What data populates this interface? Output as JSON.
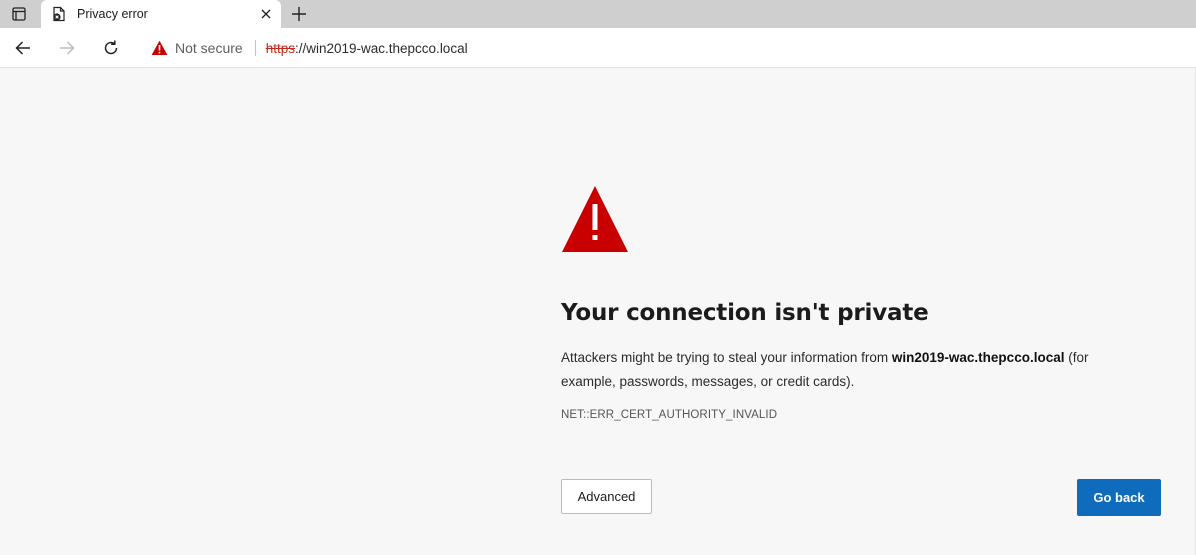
{
  "tab": {
    "title": "Privacy error"
  },
  "address_bar": {
    "security_label": "Not secure",
    "url_scheme": "https",
    "url_rest": "://win2019-wac.thepcco.local"
  },
  "page": {
    "heading": "Your connection isn't private",
    "description_before": "Attackers might be trying to steal your information from ",
    "description_host": "win2019-wac.thepcco.local",
    "description_after": " (for example, passwords, messages, or credit cards).",
    "error_code": "NET::ERR_CERT_AUTHORITY_INVALID",
    "advanced_label": "Advanced",
    "go_back_label": "Go back"
  },
  "colors": {
    "warning_red": "#c80000",
    "primary_button": "#0f6cbd",
    "not_secure_red": "#c42b1c"
  },
  "icons": {
    "tab_actions": "tab-actions-icon",
    "favicon": "document-error-icon",
    "close": "close-icon",
    "new_tab": "plus-icon",
    "back": "back-arrow-icon",
    "forward": "forward-arrow-icon",
    "refresh": "refresh-icon",
    "security": "warning-triangle-icon",
    "page_warning": "warning-triangle-icon"
  }
}
